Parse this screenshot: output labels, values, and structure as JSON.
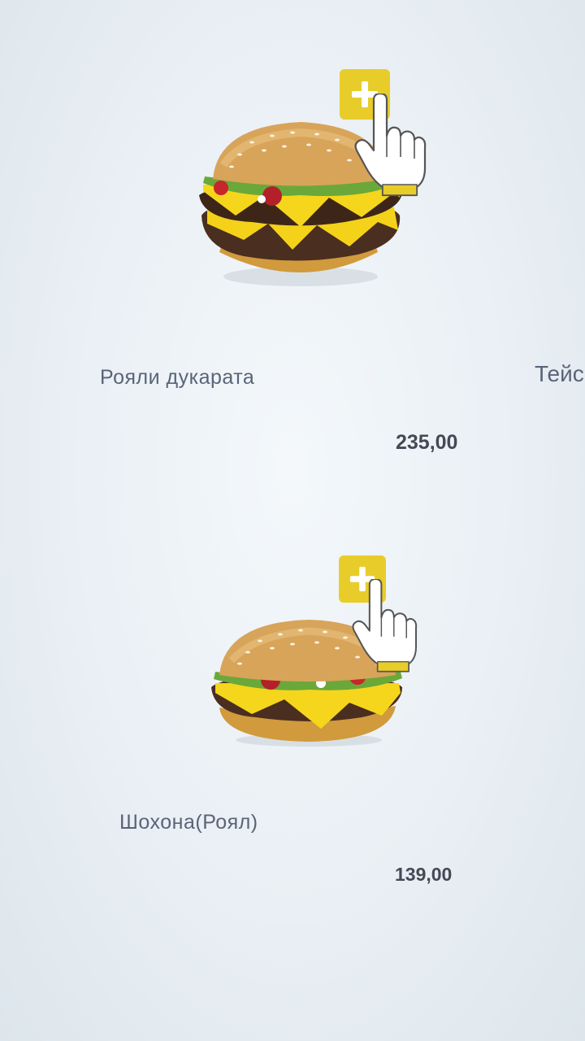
{
  "products": [
    {
      "name": "Рояли дукарата",
      "price": "235,00"
    },
    {
      "name": "Шохона(Роял)",
      "price": "139,00"
    }
  ],
  "next_product_partial": "Тейс",
  "colors": {
    "accent": "#e8cd2a",
    "text": "#5a6478",
    "price": "#444a55"
  },
  "icons": {
    "add": "plus-icon",
    "pointer": "hand-pointer-icon"
  }
}
